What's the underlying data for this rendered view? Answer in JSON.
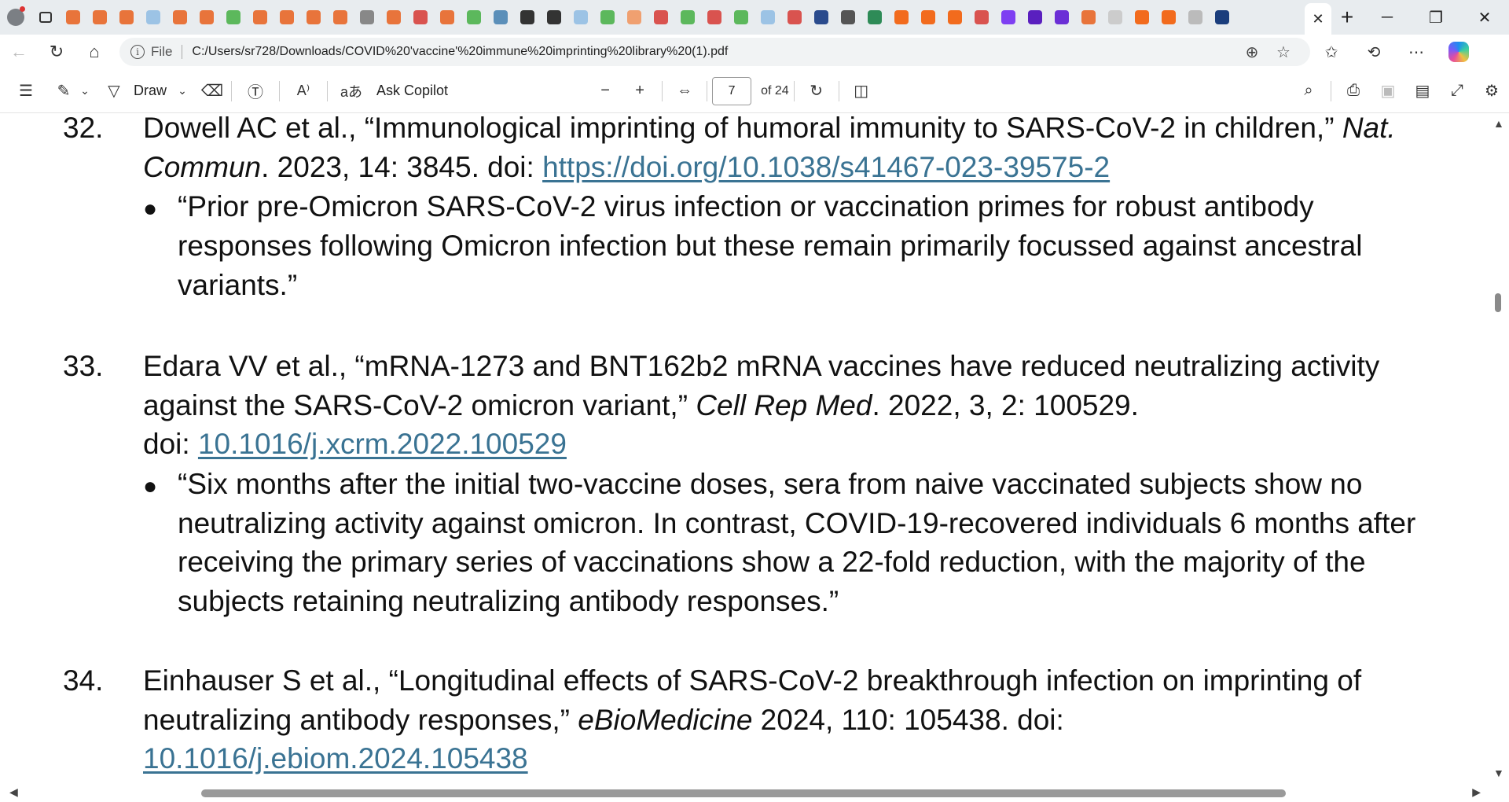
{
  "browser": {
    "tab_favicon_colors": [
      "#e8743b",
      "#e8743b",
      "#e8743b",
      "#9cc3e5",
      "#e8743b",
      "#e8743b",
      "#5cb85c",
      "#e8743b",
      "#e8743b",
      "#e8743b",
      "#e8743b",
      "#888888",
      "#e8743b",
      "#d9534f",
      "#e8743b",
      "#5cb85c",
      "#5b8fb9",
      "#333333",
      "#333333",
      "#9cc3e5",
      "#5cb85c",
      "#f0a070",
      "#d9534f",
      "#5cb85c",
      "#d9534f",
      "#5cb85c",
      "#9cc3e5",
      "#d9534f",
      "#2a4b8d",
      "#555555",
      "#2e8b57",
      "#f26b1d",
      "#f26b1d",
      "#f26b1d",
      "#d9534f",
      "#7e3ff2",
      "#5a1fbf",
      "#6b2fd6",
      "#e8743b",
      "#cccccc",
      "#f26b1d",
      "#f26b1d",
      "#bbbbbb",
      "#1a3d7c"
    ],
    "active_tab_close": "✕",
    "new_tab": "+",
    "address": {
      "file_label": "File",
      "url": "C:/Users/sr728/Downloads/COVID%20'vaccine'%20immune%20imprinting%20library%20(1).pdf"
    }
  },
  "pdf_toolbar": {
    "draw_label": "Draw",
    "ask_copilot_label": "Ask Copilot",
    "current_page": "7",
    "page_of": "of 24",
    "minus": "−",
    "plus": "+"
  },
  "references": [
    {
      "number": "32.",
      "line1": {
        "pre": "Dowell AC et al., “Immunological imprinting of humoral immunity to SARS-CoV-2 in children,” ",
        "italic": "Nat."
      },
      "line2": {
        "italic": "Commun",
        "pre": ". 2023, 14: 3845. doi: ",
        "link": "https://doi.org/10.1038/s41467-023-39575-2"
      },
      "quote_lines": [
        "“Prior pre-Omicron SARS-CoV-2 virus infection or vaccination primes for robust antibody",
        "responses following Omicron infection but these remain primarily focussed against ancestral",
        "variants.”"
      ]
    },
    {
      "number": "33.",
      "line1": "Edara VV et al., “mRNA-1273 and BNT162b2 mRNA vaccines have reduced neutralizing activity",
      "line2": {
        "pre": "against the SARS-CoV-2 omicron variant,” ",
        "italic": "Cell Rep Med",
        "post": ". 2022, 3, 2: 100529."
      },
      "line3": {
        "pre": "doi: ",
        "link": "10.1016/j.xcrm.2022.100529"
      },
      "quote_lines": [
        "“Six months after the initial two-vaccine doses, sera from naive vaccinated subjects show no",
        "neutralizing activity against omicron. In contrast, COVID-19-recovered individuals 6 months after",
        "receiving the primary series of vaccinations show a 22-fold reduction, with the majority of the",
        "subjects retaining neutralizing antibody responses.”"
      ]
    },
    {
      "number": "34.",
      "line1": "Einhauser S et al., “Longitudinal effects of SARS-CoV-2 breakthrough infection on imprinting of",
      "line2": {
        "pre": "neutralizing antibody responses,” ",
        "italic": "eBioMedicine",
        "post": " 2024, 110: 105438. doi:"
      },
      "line3": {
        "link": "10.1016/j.ebiom.2024.105438"
      }
    }
  ],
  "bullet_char": "●"
}
